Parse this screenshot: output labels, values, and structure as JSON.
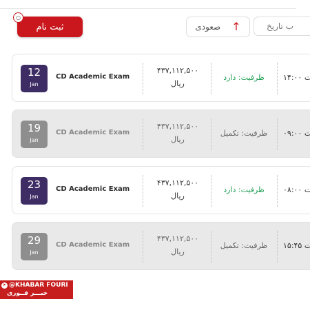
{
  "header": {
    "register_label": "ثبت نام",
    "register_dot_glyph": "○",
    "sort_label": "صعودی",
    "sort_icon": "arrow-up-icon",
    "date_filter_label": "ب تاریخ"
  },
  "exams": [
    {
      "day": "12",
      "month": "Jan",
      "name": "CD Academic Exam",
      "price": "۴۳۷,۱۱۲,۵۰۰",
      "currency": "ریال",
      "capacity": "ظرفیت: دارد",
      "status": "open",
      "time": "ت ۱۴:۰۰"
    },
    {
      "day": "19",
      "month": "Jan",
      "name": "CD Academic Exam",
      "price": "۴۳۷,۱۱۲,۵۰۰",
      "currency": "ریال",
      "capacity": "ظرفیت: تکمیل",
      "status": "full",
      "time": "ت ۰۹:۰۰"
    },
    {
      "day": "23",
      "month": "Jan",
      "name": "CD Academic Exam",
      "price": "۴۳۷,۱۱۲,۵۰۰",
      "currency": "ریال",
      "capacity": "ظرفیت: دارد",
      "status": "open",
      "time": "ت ۰۸:۰۰"
    },
    {
      "day": "29",
      "month": "Jan",
      "name": "CD Academic Exam",
      "price": "۴۳۷,۱۱۲,۵۰۰",
      "currency": "ریال",
      "capacity": "ظرفیت: تکمیل",
      "status": "full",
      "time": "ت ۱۵:۴۵"
    }
  ],
  "watermark": {
    "handle": "@KHABAR FOURI",
    "persian": "خبـــر فــوری",
    "icon": "telegram-icon"
  },
  "colors": {
    "accent_red": "#c9171d",
    "badge_open": "#3e2d64",
    "badge_full": "#8e8e8e",
    "capacity_open": "#1e9e54"
  }
}
